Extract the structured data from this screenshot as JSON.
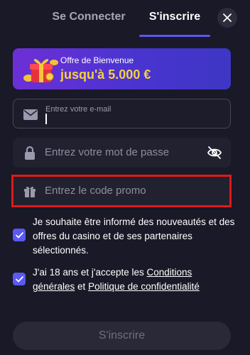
{
  "tabs": {
    "login": "Se Connecter",
    "signup": "S'inscrire"
  },
  "banner": {
    "subtitle": "Offre de Bienvenue",
    "title": "jusqu'à 5.000 €"
  },
  "form": {
    "email_label": "Entrez votre e-mail",
    "email_value": "",
    "password_placeholder": "Entrez votre mot de passe",
    "promo_placeholder": "Entrez le code promo"
  },
  "consents": {
    "newsletter": "Je souhaite être informé des nouveautés et des offres du casino et de ses partenaires sélectionnés.",
    "terms_prefix": "J'ai 18 ans et j'accepte les ",
    "terms_link": "Conditions générales",
    "terms_and": " et ",
    "privacy_link": "Politique de confidentialité"
  },
  "submit_label": "S'inscrire",
  "colors": {
    "background": "#191927",
    "accent": "#5b59f2",
    "banner_title": "#f3d23a",
    "highlight": "#e01919"
  }
}
